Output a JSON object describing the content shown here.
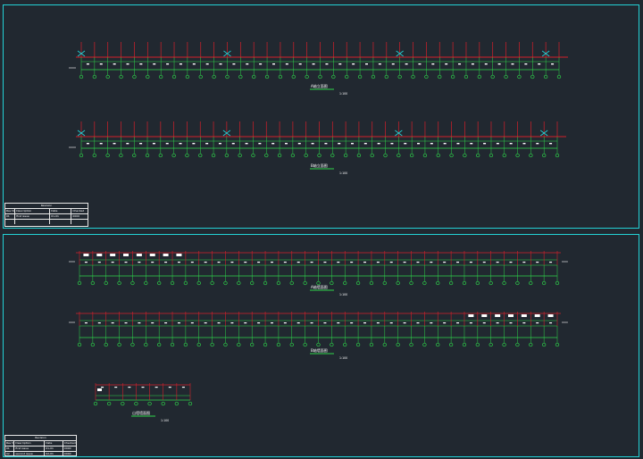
{
  "colors": {
    "background": "#212830",
    "frame": "#23d2d6",
    "column": "#d4202a",
    "beam": "#d4202a",
    "axis": "#2ed64a",
    "bubble": "#2ed64a",
    "label": "#ffffff",
    "brace": "#23d2d6",
    "underline": "#2ed64a"
  },
  "sheet_top": {
    "revision_table": {
      "title": "Revision",
      "headers": [
        "Rev No.",
        "Description",
        "Date",
        "Checked"
      ],
      "rows": [
        [
          "01",
          "first issue",
          "01-01",
          "0000"
        ]
      ]
    },
    "views": [
      {
        "name": "A轴立面图",
        "scale": "1:100"
      },
      {
        "name": "B轴立面图",
        "scale": "1:100"
      }
    ]
  },
  "sheet_bottom": {
    "revision_table": {
      "title": "Revision",
      "headers": [
        "Rev No.",
        "Description",
        "Date",
        "Checked"
      ],
      "rows": [
        [
          "01",
          "first issue",
          "01-01",
          "0000"
        ],
        [
          "02",
          "second issue",
          "02-01",
          "0000"
        ]
      ]
    },
    "views": [
      {
        "name": "A轴墙面图",
        "scale": "1:100"
      },
      {
        "name": "B轴墙面图",
        "scale": "1:100"
      },
      {
        "name": "山墙墙面图",
        "scale": "1:100"
      }
    ]
  }
}
